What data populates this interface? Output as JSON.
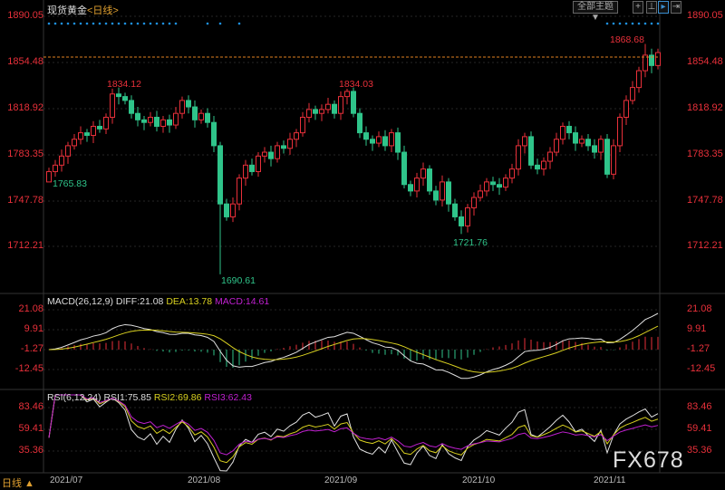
{
  "header": {
    "instrument": "现货黄金",
    "period": "<日线>",
    "theme_button": "全部主题▼",
    "tool_icons": [
      "crosshair-icon",
      "range-icon",
      "play-icon",
      "exit-icon"
    ]
  },
  "main_axis": {
    "labels": [
      "1890.05",
      "1854.48",
      "1818.92",
      "1783.35",
      "1747.78",
      "1712.21"
    ]
  },
  "annotations": {
    "high1": "1834.12",
    "high2": "1834.03",
    "recent_high": "1868.68",
    "low1": "1765.83",
    "low2": "1690.61",
    "low3": "1721.76"
  },
  "macd": {
    "title": "MACD(26,12,9)",
    "diff": "DIFF:21.08",
    "dea": "DEA:13.78",
    "macd": "MACD:14.61",
    "axis": [
      "21.08",
      "9.91",
      "-1.27",
      "-12.45"
    ]
  },
  "rsi": {
    "title": "RSI(6,12,24)",
    "rsi1": "RSI1:75.85",
    "rsi2": "RSI2:69.86",
    "rsi3": "RSI3:62.43",
    "axis": [
      "83.46",
      "59.41",
      "35.36"
    ]
  },
  "dates": [
    "2021/07",
    "2021/08",
    "2021/09",
    "2021/10",
    "2021/11"
  ],
  "footer": {
    "period_label": "日线 ▲",
    "watermark": "FX678"
  },
  "colors": {
    "up": "#e8303a",
    "down": "#2fc48a",
    "diff": "#e0e0e0",
    "dea": "#d8d020",
    "macd": "#c020d0"
  },
  "chart_data": {
    "type": "candlestick",
    "price_range": [
      1690,
      1890.05
    ],
    "closes": [
      1770,
      1775,
      1782,
      1790,
      1795,
      1800,
      1798,
      1805,
      1803,
      1812,
      1830,
      1828,
      1825,
      1815,
      1810,
      1808,
      1812,
      1805,
      1810,
      1806,
      1815,
      1825,
      1820,
      1810,
      1815,
      1808,
      1790,
      1745,
      1735,
      1745,
      1765,
      1775,
      1770,
      1782,
      1785,
      1780,
      1790,
      1788,
      1795,
      1800,
      1812,
      1818,
      1815,
      1818,
      1822,
      1815,
      1828,
      1832,
      1815,
      1800,
      1795,
      1792,
      1797,
      1790,
      1800,
      1785,
      1760,
      1755,
      1765,
      1772,
      1755,
      1748,
      1762,
      1745,
      1735,
      1728,
      1742,
      1750,
      1755,
      1762,
      1760,
      1758,
      1765,
      1772,
      1790,
      1797,
      1775,
      1772,
      1778,
      1785,
      1795,
      1805,
      1800,
      1792,
      1795,
      1790,
      1785,
      1795,
      1768,
      1790,
      1812,
      1825,
      1835,
      1848,
      1860,
      1852,
      1862
    ],
    "first_open": 1762,
    "low_overrides": {
      "0": 1765.83,
      "27": 1690.61,
      "65": 1721.76
    },
    "high_overrides": {
      "10": 1834.12,
      "47": 1834.03,
      "94": 1868.68
    }
  }
}
